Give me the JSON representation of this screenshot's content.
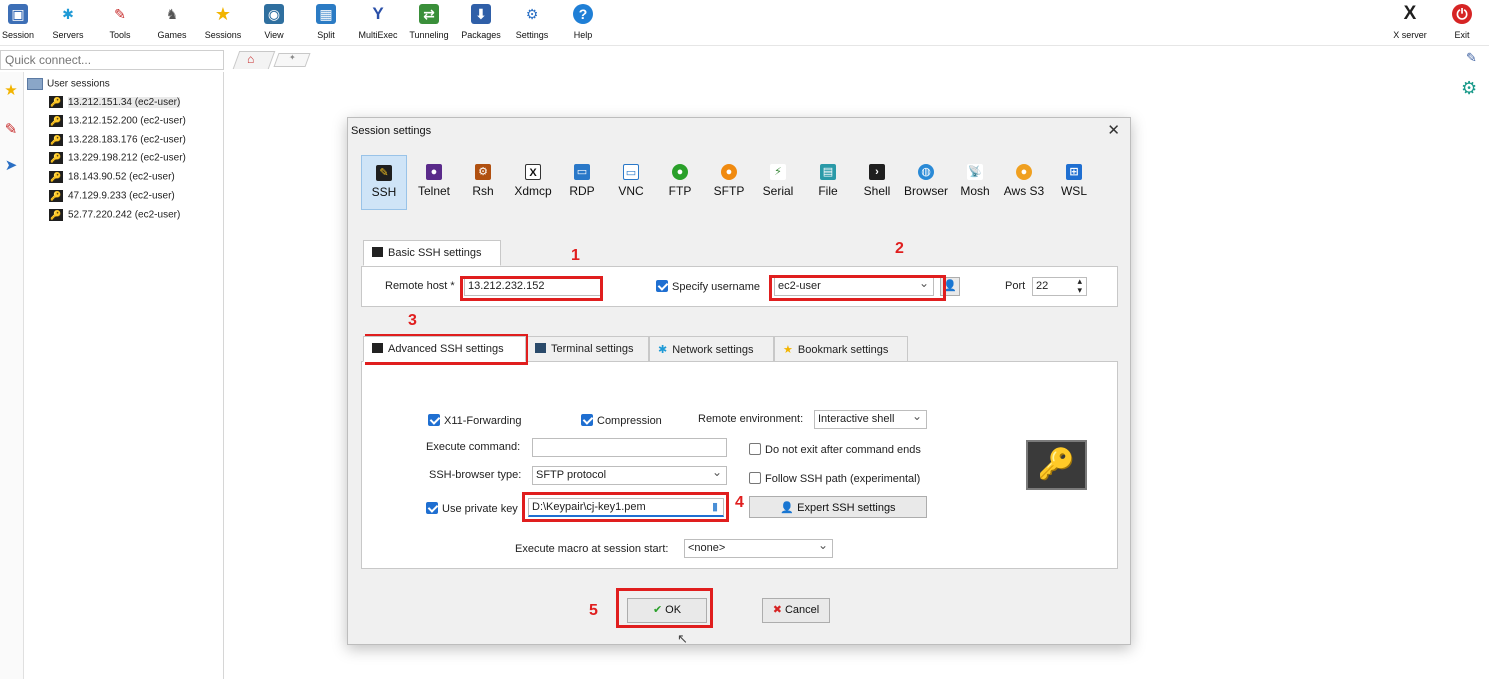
{
  "toolbar": {
    "items": [
      {
        "label": "Session",
        "icon": "session-icon"
      },
      {
        "label": "Servers",
        "icon": "servers-icon"
      },
      {
        "label": "Tools",
        "icon": "tools-icon"
      },
      {
        "label": "Games",
        "icon": "games-icon"
      },
      {
        "label": "Sessions",
        "icon": "star-icon"
      },
      {
        "label": "View",
        "icon": "view-icon"
      },
      {
        "label": "Split",
        "icon": "split-icon"
      },
      {
        "label": "MultiExec",
        "icon": "multiexec-icon"
      },
      {
        "label": "Tunneling",
        "icon": "tunneling-icon"
      },
      {
        "label": "Packages",
        "icon": "packages-icon"
      },
      {
        "label": "Settings",
        "icon": "settings-icon"
      },
      {
        "label": "Help",
        "icon": "help-icon"
      }
    ],
    "xserver_label": "X server",
    "exit_label": "Exit"
  },
  "quick_connect": {
    "placeholder": "Quick connect..."
  },
  "sessions": {
    "root_label": "User sessions",
    "items": [
      "13.212.151.34 (ec2-user)",
      "13.212.152.200 (ec2-user)",
      "13.228.183.176 (ec2-user)",
      "13.229.198.212 (ec2-user)",
      "18.143.90.52 (ec2-user)",
      "47.129.9.233 (ec2-user)",
      "52.77.220.242 (ec2-user)"
    ]
  },
  "dialog": {
    "title": "Session settings",
    "session_types": [
      "SSH",
      "Telnet",
      "Rsh",
      "Xdmcp",
      "RDP",
      "VNC",
      "FTP",
      "SFTP",
      "Serial",
      "File",
      "Shell",
      "Browser",
      "Mosh",
      "Aws S3",
      "WSL"
    ],
    "basic_tab": "Basic SSH settings",
    "remote_host_label": "Remote host *",
    "remote_host_value": "13.212.232.152",
    "specify_username_label": "Specify username",
    "username_value": "ec2-user",
    "port_label": "Port",
    "port_value": "22",
    "tabs": [
      "Advanced SSH settings",
      "Terminal settings",
      "Network settings",
      "Bookmark settings"
    ],
    "adv": {
      "x11_label": "X11-Forwarding",
      "compression_label": "Compression",
      "remote_env_label": "Remote environment:",
      "remote_env_value": "Interactive shell",
      "exec_cmd_label": "Execute command:",
      "exec_cmd_value": "",
      "no_exit_label": "Do not exit after command ends",
      "browser_type_label": "SSH-browser type:",
      "browser_type_value": "SFTP protocol",
      "follow_path_label": "Follow SSH path (experimental)",
      "private_key_label": "Use private key",
      "private_key_value": "D:\\Keypair\\cj-key1.pem",
      "expert_btn": "Expert SSH settings",
      "macro_label": "Execute macro at session start:",
      "macro_value": "<none>"
    },
    "ok_label": "OK",
    "cancel_label": "Cancel"
  },
  "annotations": [
    "1",
    "2",
    "3",
    "4",
    "5"
  ]
}
